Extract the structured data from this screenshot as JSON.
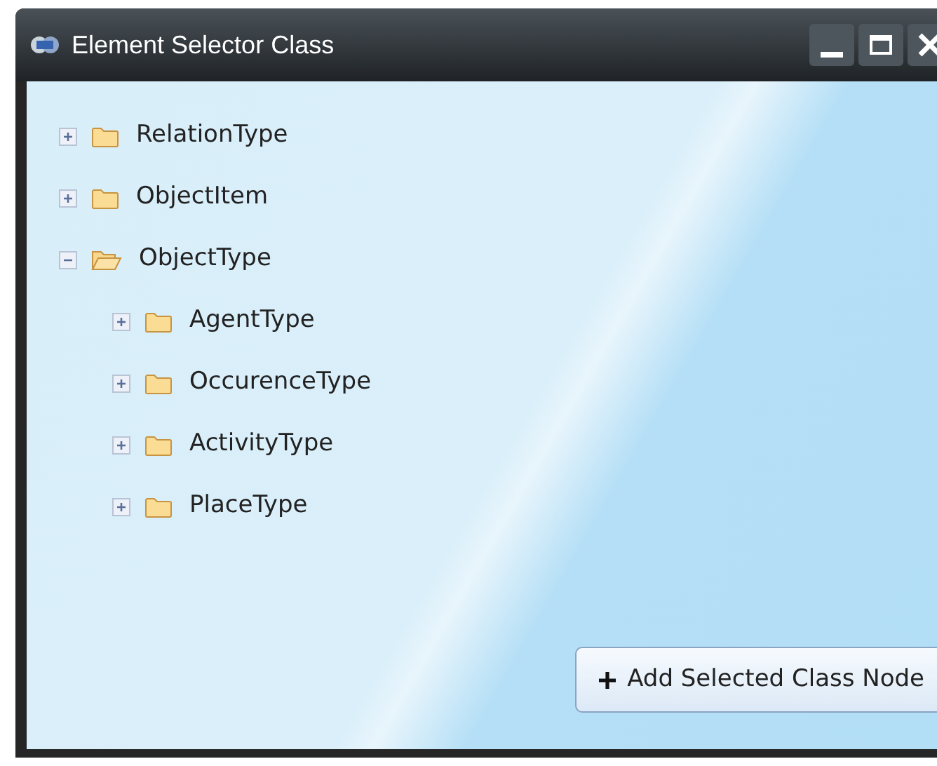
{
  "window": {
    "title": "Element Selector Class"
  },
  "tree": [
    {
      "label": "RelationType",
      "expanded": false
    },
    {
      "label": "ObjectItem",
      "expanded": false
    },
    {
      "label": "ObjectType",
      "expanded": true,
      "children": [
        {
          "label": "AgentType",
          "expanded": false
        },
        {
          "label": "OccurenceType",
          "expanded": false
        },
        {
          "label": "ActivityType",
          "expanded": false
        },
        {
          "label": "PlaceType",
          "expanded": false
        }
      ]
    }
  ],
  "add_button": {
    "label": "Add Selected Class Node"
  }
}
